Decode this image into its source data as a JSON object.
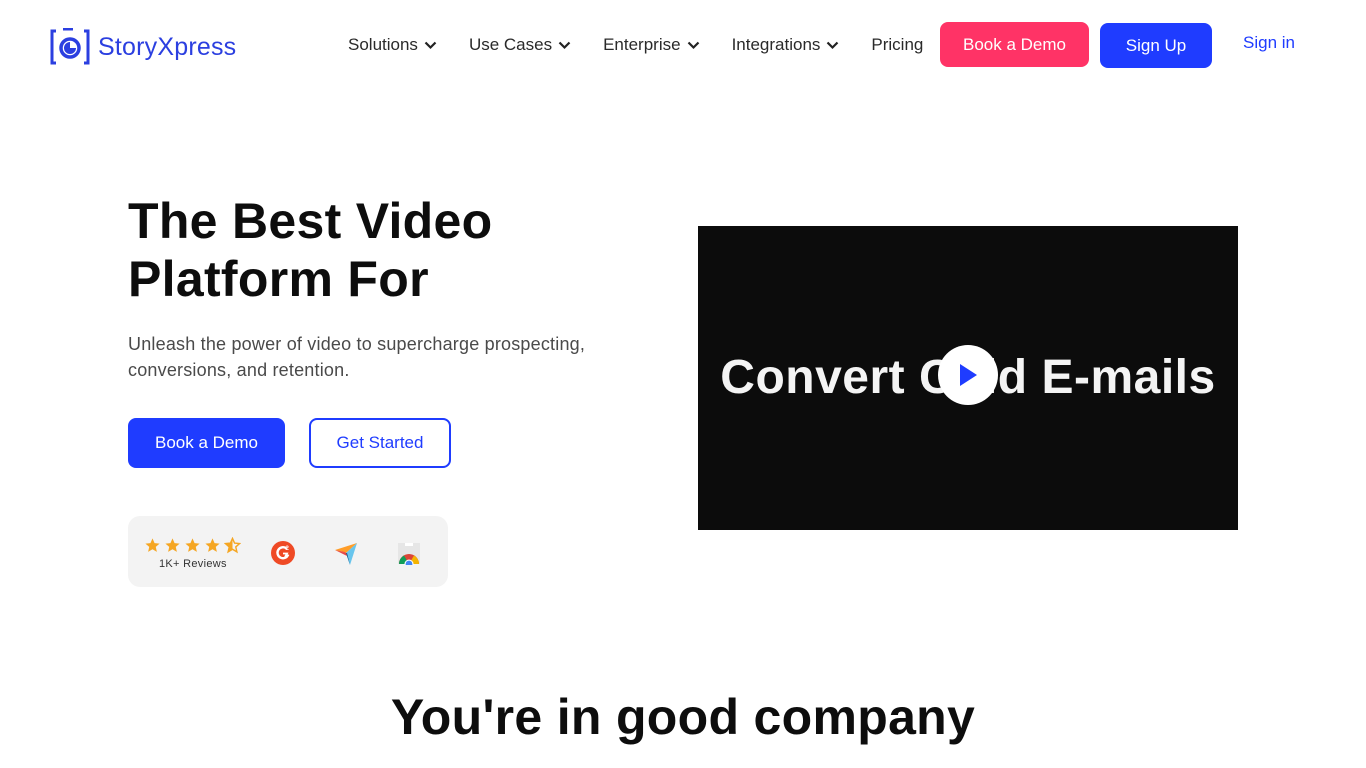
{
  "header": {
    "logo_text": "StoryXpress",
    "nav": [
      {
        "label": "Solutions",
        "has_dropdown": true
      },
      {
        "label": "Use Cases",
        "has_dropdown": true
      },
      {
        "label": "Enterprise",
        "has_dropdown": true
      },
      {
        "label": "Integrations",
        "has_dropdown": true
      },
      {
        "label": "Pricing",
        "has_dropdown": false
      }
    ],
    "book_demo_label": "Book a Demo",
    "sign_up_label": "Sign Up",
    "sign_in_label": "Sign in"
  },
  "hero": {
    "title_line1": "The Best Video",
    "title_line2": "Platform For",
    "subtitle": "Unleash the power of video to supercharge prospecting, conversions, and retention.",
    "book_demo_label": "Book a Demo",
    "get_started_label": "Get Started"
  },
  "reviews": {
    "rating": 4.5,
    "max_rating": 5,
    "count_label": "1K+ Reviews",
    "badges": [
      "g2-icon",
      "capterra-icon",
      "chrome-web-store-icon"
    ]
  },
  "video": {
    "caption": "Convert Cold E-mails",
    "play_icon": "play-icon"
  },
  "section": {
    "title": "You're in good company"
  },
  "colors": {
    "brand_blue": "#1f3cff",
    "accent_pink": "#ff3366",
    "star_orange": "#f5a623",
    "card_bg": "#f3f3f3",
    "video_bg": "#0c0c0c"
  }
}
